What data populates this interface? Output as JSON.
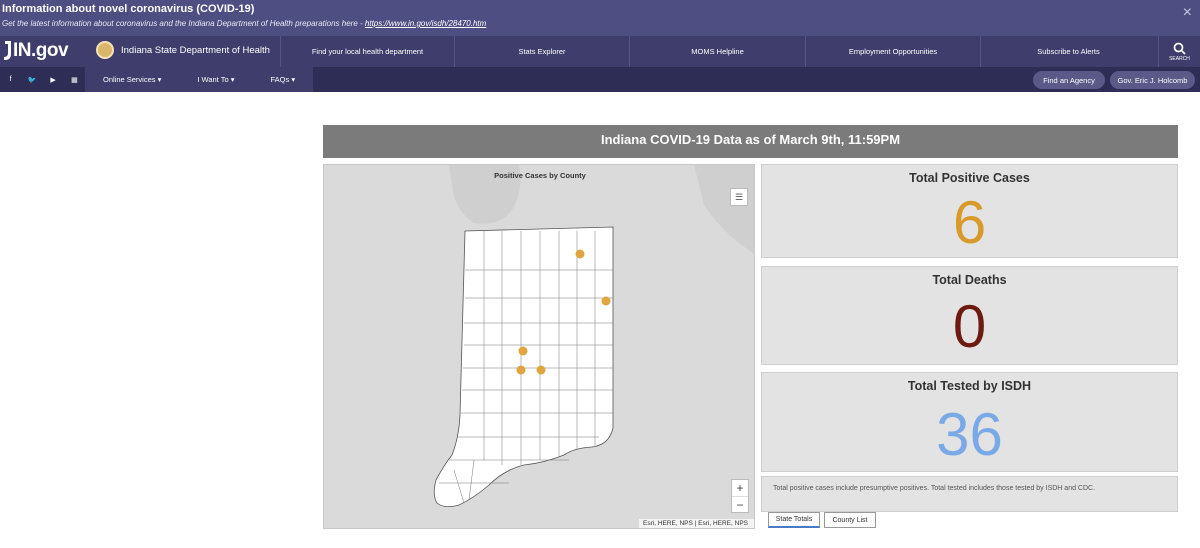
{
  "alert": {
    "title": "Information about novel coronavirus (COVID-19)",
    "subtitle": "Get the latest information about coronavirus and the Indiana Department of Health preparations here - ",
    "link": "https://www.in.gov/isdh/28470.htm",
    "close_icon": "×"
  },
  "header": {
    "logo": "IN.gov",
    "agency": "Indiana State Department of Health",
    "nav": [
      "Find your local health department",
      "Stats Explorer",
      "MOMS Helpline",
      "Employment Opportunities",
      "Subscribe to Alerts"
    ],
    "search_label": "SEARCH"
  },
  "subbar": {
    "social_icons": [
      "facebook-icon",
      "twitter-icon",
      "youtube-icon",
      "calendar-icon"
    ],
    "social_glyphs": [
      "f",
      "🐦",
      "▶",
      "▦"
    ],
    "menu": [
      "Online Services ▾",
      "I Want To ▾",
      "FAQs ▾"
    ],
    "pills": [
      "Find an Agency",
      "Gov. Eric J. Holcomb"
    ]
  },
  "dashboard": {
    "title": "Indiana COVID-19 Data as of March 9th, 11:59PM",
    "map": {
      "title": "Positive Cases by County",
      "zoom_in": "+",
      "zoom_out": "−",
      "legend_glyph": "☰",
      "attribution": "Esri, HERE, NPS | Esri, HERE, NPS",
      "case_marker_color": "#e0a53e"
    },
    "stats": [
      {
        "label": "Total Positive Cases",
        "value": "6",
        "color": "#d99a2b"
      },
      {
        "label": "Total Deaths",
        "value": "0",
        "color": "#6e1a10"
      },
      {
        "label": "Total Tested by ISDH",
        "value": "36",
        "color": "#7aa9e8"
      }
    ],
    "note": "Total positive cases include presumptive positives.  Total tested includes those tested by ISDH and CDC.",
    "tabs": [
      "State Totals",
      "County List"
    ]
  }
}
